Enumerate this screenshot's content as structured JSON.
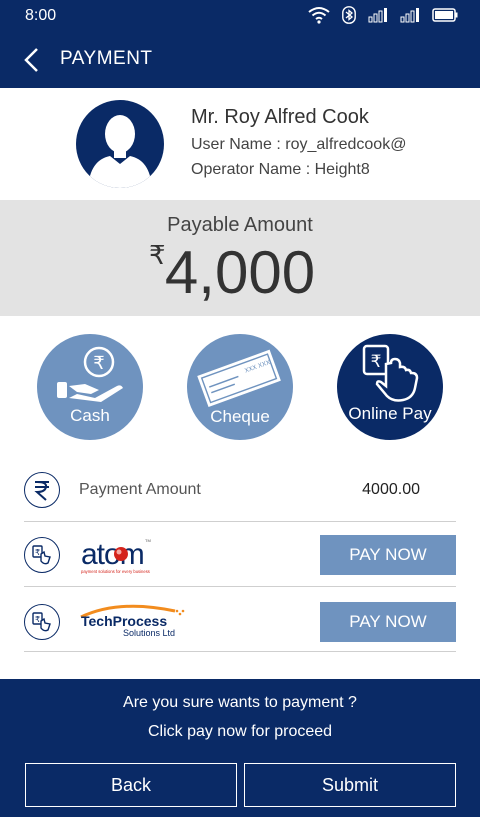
{
  "status_bar": {
    "time": "8:00",
    "icons": [
      "wifi-icon",
      "bluetooth-icon",
      "signal-icon",
      "signal-icon",
      "battery-icon"
    ]
  },
  "app_bar": {
    "title": "PAYMENT",
    "back_icon": "chevron-left-icon"
  },
  "profile": {
    "name": "Mr. Roy Alfred Cook",
    "username": "User Name : roy_alfredcook@",
    "operator": "Operator Name : Height8"
  },
  "payable": {
    "label": "Payable Amount",
    "currency": "₹",
    "amount": "4,000"
  },
  "methods": [
    {
      "label": "Cash",
      "selected": false
    },
    {
      "label": "Cheque",
      "selected": false,
      "cheque_text": "XXX XXX"
    },
    {
      "label": "Online Pay",
      "selected": true
    }
  ],
  "payment_amount": {
    "label": "Payment Amount",
    "value": "4000.00"
  },
  "gateways": [
    {
      "logo_text": "atom",
      "tagline": "payment solutions for every business",
      "button": "PAY NOW"
    },
    {
      "logo_text": "TechProcess",
      "sub_text": "Solutions Ltd",
      "button": "PAY NOW"
    }
  ],
  "footer": {
    "confirm_line1": "Are you sure wants to payment ?",
    "confirm_line2": "Click pay now for proceed",
    "back_label": "Back",
    "submit_label": "Submit"
  },
  "colors": {
    "primary": "#0a2a66",
    "accent": "#6f93bf",
    "panel": "#e3e3e3",
    "logo_red": "#d4241c",
    "logo_orange": "#f28c1e"
  }
}
